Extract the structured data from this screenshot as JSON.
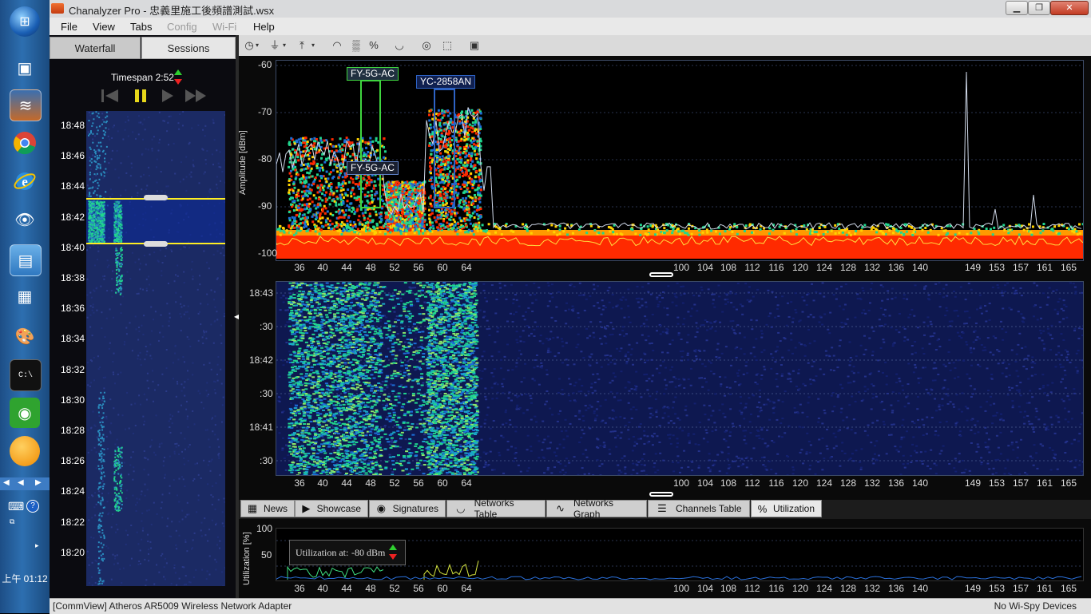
{
  "window": {
    "title": "Chanalyzer Pro - 忠義里施工後頻譜測試.wsx",
    "minimize": "▁",
    "maximize": "❐",
    "close": "✕"
  },
  "menu": {
    "file": "File",
    "view": "View",
    "tabs": "Tabs",
    "config": "Config",
    "wifi": "Wi-Fi",
    "help": "Help"
  },
  "taskbar": {
    "clock": "上午 01:12",
    "keyboard_icon": "⌨",
    "help_icon": "?"
  },
  "left": {
    "tabs": {
      "waterfall": "Waterfall",
      "sessions": "Sessions"
    },
    "timespan": "Timespan 2:52",
    "times": [
      "18:48",
      "18:46",
      "18:44",
      "18:42",
      "18:40",
      "18:38",
      "18:36",
      "18:34",
      "18:32",
      "18:30",
      "18:28",
      "18:26",
      "18:24",
      "18:22",
      "18:20"
    ]
  },
  "spectrum": {
    "ylabel": "Amplitude [dBm]",
    "yticks": [
      "-60",
      "-70",
      "-80",
      "-90",
      "-100"
    ],
    "ylim": [
      -100,
      -57
    ],
    "networks": [
      {
        "label": "FY-5G-AC",
        "color": "#3fd53f"
      },
      {
        "label": "FY-5G-AC",
        "color": "#5f82c8"
      },
      {
        "label": "YC-2858AN",
        "color": "#2e63c5"
      }
    ]
  },
  "channels": [
    "36",
    "40",
    "44",
    "48",
    "52",
    "56",
    "60",
    "64",
    "100",
    "104",
    "108",
    "112",
    "116",
    "120",
    "124",
    "128",
    "132",
    "136",
    "140",
    "149",
    "153",
    "157",
    "161",
    "165"
  ],
  "waterfall": {
    "times": [
      "18:43",
      ":30",
      "18:42",
      ":30",
      "18:41",
      ":30"
    ]
  },
  "bottom_tabs": [
    "News",
    "Showcase",
    "Signatures",
    "Networks Table",
    "Networks Graph",
    "Channels Table",
    "Utilization"
  ],
  "utilization": {
    "ylabel": "Utilization [%]",
    "yticks": [
      "100",
      "50"
    ],
    "at_label": "Utilization at:",
    "at_value": "-80 dBm"
  },
  "status": {
    "adapter": "[CommView] Atheros AR5009 Wireless Network Adapter",
    "devices": "No Wi-Spy Devices"
  },
  "colors": {
    "hot": "#ff2a00",
    "warm": "#ffd200",
    "cool": "#21d68e",
    "cold": "#1a2a8a"
  }
}
